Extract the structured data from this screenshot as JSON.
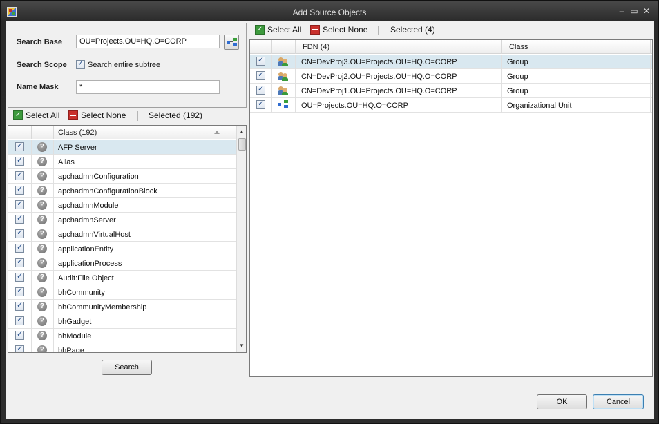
{
  "window": {
    "title": "Add Source Objects"
  },
  "search": {
    "base_label": "Search Base",
    "base_value": "OU=Projects.OU=HQ.O=CORP",
    "scope_label": "Search Scope",
    "scope_option": "Search entire subtree",
    "scope_checked": true,
    "mask_label": "Name Mask",
    "mask_value": "*",
    "search_button": "Search"
  },
  "class_toolbar": {
    "select_all": "Select All",
    "select_none": "Select None",
    "selected": "Selected (192)"
  },
  "class_grid": {
    "header": "Class  (192)",
    "rows": [
      "AFP Server",
      "Alias",
      "apchadmnConfiguration",
      "apchadmnConfigurationBlock",
      "apchadmnModule",
      "apchadmnServer",
      "apchadmnVirtualHost",
      "applicationEntity",
      "applicationProcess",
      "Audit:File Object",
      "bhCommunity",
      "bhCommunityMembership",
      "bhGadget",
      "bhModule",
      "bhPage"
    ]
  },
  "objects_toolbar": {
    "select_all": "Select All",
    "select_none": "Select None",
    "selected": "Selected (4)"
  },
  "objects_grid": {
    "headers": {
      "fdn": "FDN  (4)",
      "class": "Class"
    },
    "rows": [
      {
        "icon": "group-icon",
        "fdn": "CN=DevProj3.OU=Projects.OU=HQ.O=CORP",
        "class": "Group"
      },
      {
        "icon": "group-icon",
        "fdn": "CN=DevProj2.OU=Projects.OU=HQ.O=CORP",
        "class": "Group"
      },
      {
        "icon": "group-icon",
        "fdn": "CN=DevProj1.OU=Projects.OU=HQ.O=CORP",
        "class": "Group"
      },
      {
        "icon": "org-unit-icon",
        "fdn": "OU=Projects.OU=HQ.O=CORP",
        "class": "Organizational Unit"
      }
    ]
  },
  "dialog_buttons": {
    "ok": "OK",
    "cancel": "Cancel"
  }
}
